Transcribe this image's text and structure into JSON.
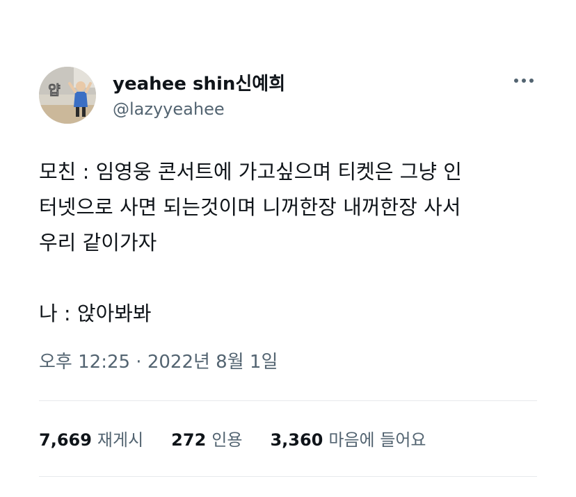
{
  "user": {
    "display_name": "yeahee shin신예희",
    "handle": "@lazyyeahee",
    "avatar_badge": "얍"
  },
  "tweet": {
    "lines": [
      "모친 : 임영웅 콘서트에 가고싶으며 티켓은 그냥 인",
      "터넷으로 사면 되는것이며 니꺼한장 내꺼한장 사서",
      "우리 같이가자",
      "",
      "나 : 앉아봐봐"
    ],
    "timestamp": "오후 12:25 · 2022년 8월 1일"
  },
  "stats": {
    "retweets": {
      "count": "7,669",
      "label": "재게시"
    },
    "quotes": {
      "count": "272",
      "label": "인용"
    },
    "likes": {
      "count": "3,360",
      "label": "마음에 들어요"
    }
  },
  "more_icon": "more-horizontal-icon",
  "colors": {
    "text_primary": "#0f1419",
    "text_secondary": "#536471",
    "divider": "#e6e9ec"
  }
}
